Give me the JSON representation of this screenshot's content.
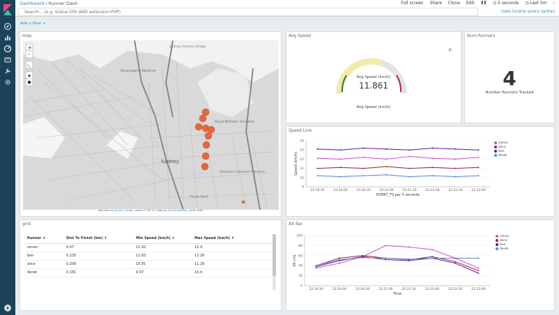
{
  "breadcrumb": {
    "root": "Dashboard",
    "sep": "/",
    "current": "Runner Dash"
  },
  "actions": [
    "Full screen",
    "Share",
    "Clone",
    "Edit"
  ],
  "refresh": {
    "pause": "❚❚",
    "interval": "5 seconds",
    "time": "Last 5m"
  },
  "search": {
    "placeholder": "Search... (e.g. status:200 AND extension:PHP)",
    "lucene": "Uses lucene query syntax"
  },
  "add_filter": "Add a filter +",
  "panels": {
    "map": {
      "title": "map",
      "attribution_a": "Map tiles by",
      "attribution_b": "Stamen Design",
      "attribution_c": ", under CC BY 3.0. Data by",
      "attribution_d": "OpenStreetMap",
      "attribution_e": ", under ODbL",
      "labels": [
        "Barangaroo Reserve",
        "Sydney",
        "Royal Botanic Gardens",
        "Domain Crescent Precinct",
        "Hyde Park",
        "Sydney Harbour Bridge"
      ]
    },
    "avg_speed": {
      "title": "Avg Speed",
      "label": "Avg Speed (km/h)",
      "value": "11.861",
      "footer": "Avg Speed (km/h)",
      "level": 0.59
    },
    "num_runners": {
      "title": "Num Runners",
      "value": "4",
      "label": "Number Runners Tracked"
    },
    "speed_line": {
      "title": "Speed Line",
      "xlabel": "EVENT_TS per 5 seconds",
      "ylabel": "Speed (km/h)"
    },
    "grid": {
      "title": "grid",
      "headers": [
        "Runner ⇕",
        "Dist To Finish (km) ⇕",
        "Min Speed (km/h) ⇕",
        "Max Speed (km/h) ⇕"
      ],
      "rows": [
        [
          "simon",
          "0.47",
          "11.92",
          "12.4"
        ],
        [
          "ben",
          "0.235",
          "12.83",
          "13.29"
        ],
        [
          "alice",
          "0.206",
          "10.81",
          "11.28"
        ],
        [
          "derek",
          "0.181",
          "9.97",
          "10.4"
        ]
      ]
    },
    "alt_bar": {
      "title": "Alt Bar",
      "xlabel": "Time",
      "ylabel": "Alt (m)"
    }
  },
  "colors": {
    "simon": "#c94dc9",
    "alice": "#a01f2e",
    "ben": "#4a1aa5",
    "derek": "#5b7fd6",
    "accent": "#2b8ec4",
    "rail": "#1b4258"
  },
  "chart_data": [
    {
      "type": "line",
      "x": [
        "22:19:30",
        "22:20:00",
        "22:20:30",
        "22:21:00",
        "22:21:30",
        "22:22:00",
        "22:22:30",
        "22:23:00"
      ],
      "xlabel": "EVENT_TS per 5 seconds",
      "ylabel": "Speed (km/h)",
      "ylim": [
        9,
        14
      ],
      "yticks": [
        9,
        10,
        11,
        12,
        13,
        14
      ],
      "series": [
        {
          "name": "simon",
          "values": [
            12.1,
            12.0,
            12.2,
            12.0,
            12.3,
            12.1,
            12.0,
            12.2
          ]
        },
        {
          "name": "alice",
          "values": [
            11.0,
            11.1,
            11.0,
            11.2,
            11.0,
            11.1,
            11.0,
            11.1
          ]
        },
        {
          "name": "ben",
          "values": [
            13.1,
            13.0,
            13.2,
            13.1,
            13.0,
            13.2,
            13.1,
            13.0
          ]
        },
        {
          "name": "derek",
          "values": [
            10.2,
            10.1,
            10.2,
            10.3,
            10.1,
            10.2,
            10.1,
            10.2
          ]
        }
      ],
      "legend": "right"
    },
    {
      "type": "line",
      "x": [
        "22:19:30",
        "22:20:00",
        "22:20:30",
        "22:21:00",
        "22:21:30",
        "22:22:00",
        "22:22:30",
        "22:23:00"
      ],
      "xlabel": "Time",
      "ylabel": "Alt (m)",
      "ylim": [
        0,
        100
      ],
      "yticks": [
        0,
        20,
        40,
        60,
        80,
        100
      ],
      "series": [
        {
          "name": "simon",
          "values": [
            35,
            45,
            58,
            80,
            77,
            72,
            55,
            35
          ]
        },
        {
          "name": "alice",
          "values": [
            40,
            55,
            60,
            55,
            52,
            58,
            48,
            30
          ]
        },
        {
          "name": "ben",
          "values": [
            38,
            50,
            58,
            52,
            50,
            55,
            45,
            25
          ]
        },
        {
          "name": "derek",
          "values": [
            40,
            52,
            56,
            55,
            53,
            55,
            55,
            55
          ]
        }
      ],
      "legend": "right"
    }
  ]
}
